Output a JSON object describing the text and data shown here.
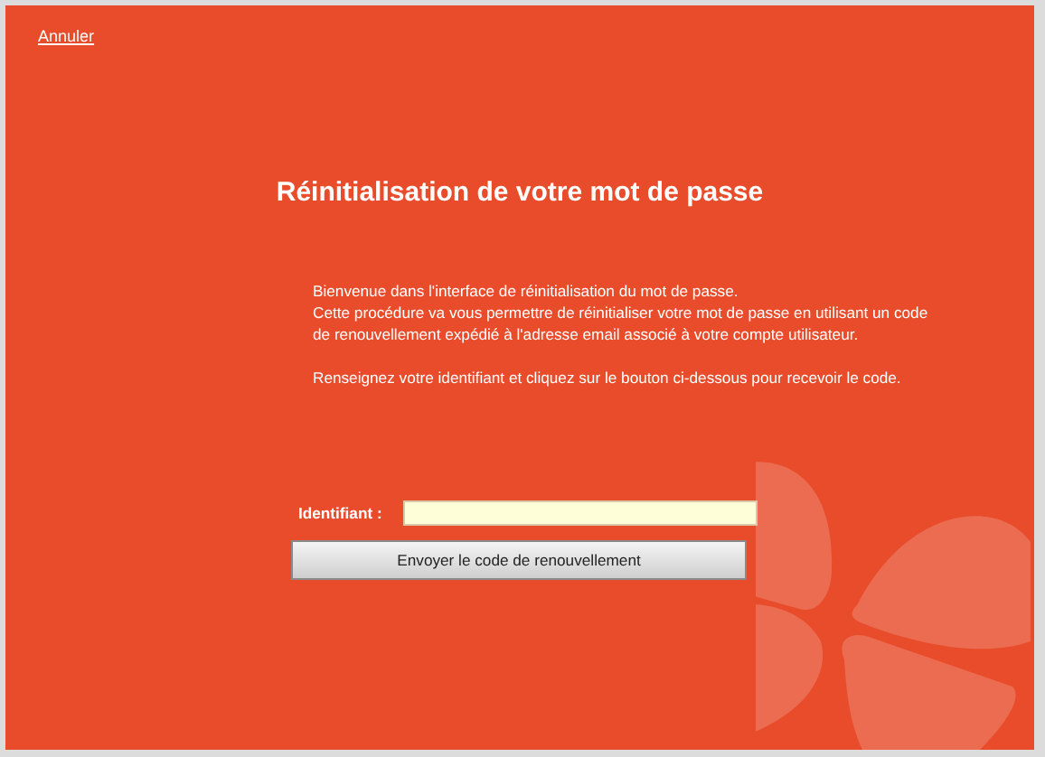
{
  "cancel_link": "Annuler",
  "title": "Réinitialisation de votre mot de passe",
  "paragraphs": [
    "Bienvenue dans l'interface de réinitialisation du mot de passe.\nCette procédure va vous permettre de réinitialiser votre mot de passe en utilisant un code de renouvellement expédié à l'adresse email associé à votre compte utilisateur.",
    "Renseignez votre identifiant et cliquez sur le bouton ci-dessous pour recevoir le code."
  ],
  "identifier_field": {
    "label": "Identifiant :"
  },
  "send_button": "Envoyer le code de renouvellement"
}
